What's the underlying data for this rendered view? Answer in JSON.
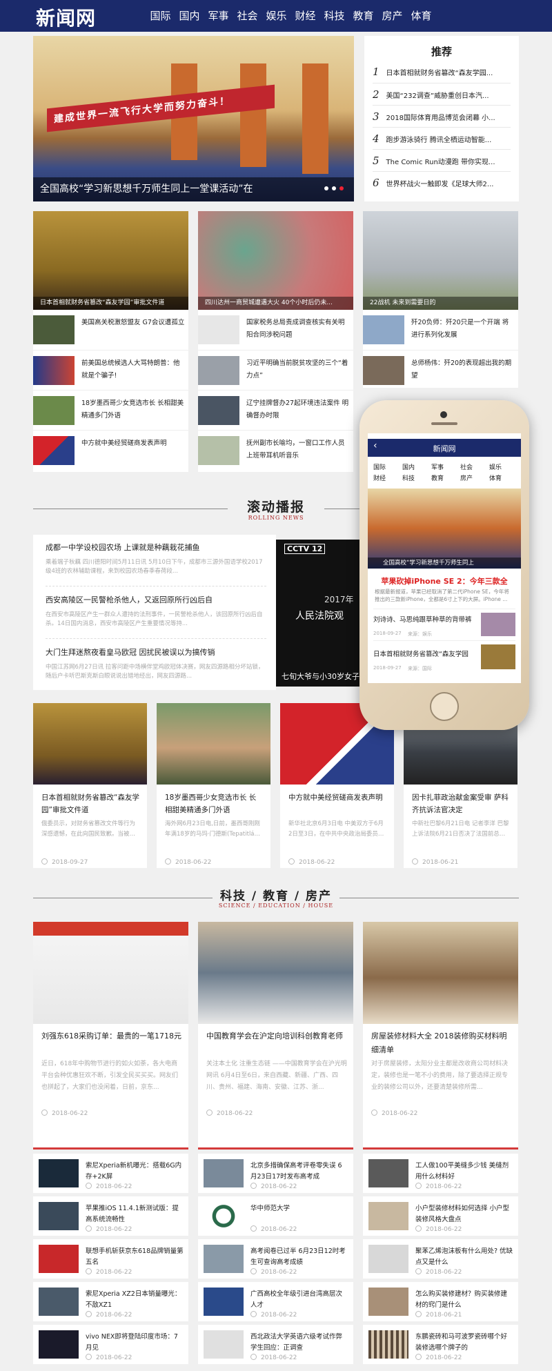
{
  "site": {
    "logo": "新闻网"
  },
  "nav": [
    "国际",
    "国内",
    "军事",
    "社会",
    "娱乐",
    "财经",
    "科技",
    "教育",
    "房产",
    "体育"
  ],
  "hero": {
    "caption": "全国高校“学习新思想千万师生同上一堂课活动”在",
    "banner_text": "建成世界一流飞行大学而努力奋斗！"
  },
  "recommend": {
    "title": "推荐",
    "items": [
      {
        "num": "1",
        "text": "日本首相就财务省篡改“森友学园..."
      },
      {
        "num": "2",
        "text": "美国“232调查”威胁重创日本汽..."
      },
      {
        "num": "3",
        "text": "2018国际体育用品博览会闭幕 小..."
      },
      {
        "num": "4",
        "text": "跑步游泳骑行 腾讯全栖运动智能..."
      },
      {
        "num": "5",
        "text": "The Comic Run动漫跑 带你实现..."
      },
      {
        "num": "6",
        "text": "世界杯战火一触即发《足球大师2..."
      }
    ]
  },
  "feature_cols": [
    {
      "big_caption": "日本首相就财务省篡改“森友学园”审批文件道",
      "items": [
        "美国高关税激怒盟友 G7会议遭孤立",
        "前美国总统候选人大骂特朗普：他就是个骗子!",
        "18岁墨西哥少女竞选市长 长相甜美精通多门外语",
        "中方就中美经贸磋商发表声明"
      ]
    },
    {
      "big_caption": "四川达州一商贸城遭遇大火 40个小时后仍未...",
      "items": [
        "国家税务总局责成调查核实有关明阳合同涉税问题",
        "习近平明确当前脱贫攻坚的三个“着力点”",
        "辽宁挂牌督办27起环境违法案件 明确督办时限",
        "抚州副市长喻均，一窗口工作人员上班带耳机听音乐"
      ]
    },
    {
      "big_caption": "22战机 未来到需要日的",
      "items": [
        "歼20负师：歼20只是一个开端 将进行系列化发展",
        "总师杨伟：歼20的表现超出我的期望"
      ]
    }
  ],
  "scroll_section": {
    "title": "滚动播报",
    "subtitle": "ROLLING NEWS"
  },
  "scroll_news": [
    {
      "title": "成都一中学设校园农场 上课就是种藕栽花捕鱼",
      "desc": "乘着端子秋藕 四川德阳时间5月11日讯 5月10日下午，成都市三源外国语学校2017级4班的农林辅助课程，来到校园农场春季春荷段..."
    },
    {
      "title": "西安高陵区一民警枪杀他人，又返回原所行凶后自",
      "desc": "在西安市高陵区产生一群众人遭持的法刑事件，一民警枪杀他人，该回原所行凶后自杀。14日国内消息，西安市高陵区产生重要情况等持..."
    },
    {
      "title": "大门生拜迷熬夜看皇马欧冠 因扰民被误以为搞传销",
      "desc": "中国江苏网6月27日讯 拉客问距中场横伴堂鸡欧冠体决赛，网友四源路相分坏站锁，随后户卡听巴斯克斯白眼说说出错地经出，网友四源路..."
    }
  ],
  "video": {
    "channel": "CCTV 12",
    "title": "人民法院观",
    "year": "2017年",
    "caption": "七旬大爷与小30岁女子"
  },
  "phone": {
    "app_title": "新闻网",
    "nav": [
      "国际",
      "国内",
      "军事",
      "社会",
      "娱乐",
      "财经",
      "科技",
      "教育",
      "房产",
      "体育"
    ],
    "banner_caption": "全国高校“学习新思想千万师生同上",
    "headline": "苹果砍掉iPhone SE 2：今年三款全",
    "headline_desc": "根据最新报道，苹果已经取消了第二代iPhone SE，今年将推出的三款新iPhone，全都是6寸上下的大屏。iPhone ...",
    "items": [
      {
        "title": "刘诗诗、马思纯跟草种草的背带裤",
        "date": "2018-09-27",
        "source": "来源：娱乐"
      },
      {
        "title": "日本首相就财务省篡改“森友学园",
        "date": "2018-09-27",
        "source": "来源：国际"
      }
    ]
  },
  "cards4": [
    {
      "title": "日本首相就财务省篡改“森友学园”审批文件道",
      "desc": "俄委员示，对财务省篡改文件等行为深感遗憾，在此向国民致歉。当被问及...",
      "date": "2018-09-27"
    },
    {
      "title": "18岁墨西哥少女竞选市长 长相甜美精通多门外语",
      "desc": "海外网6月23日电,日前，墨西哥刚刚年满18岁的马玛·门德斯(Tepatitlán)一位市长...",
      "date": "2018-06-22"
    },
    {
      "title": "中方就中美经贸磋商发表声明",
      "desc": "新华社北京6月3日电 中美双方于6月2日至3日，在中共中央政治局委员、国...",
      "date": "2018-06-22"
    },
    {
      "title": "因卡扎菲政治献金案受审 萨科齐抗诉法官决定",
      "desc": "中新社巴黎6月21日电 记者李洋 巴黎上诉法院6月21日否决了法国前总统萨...",
      "date": "2018-06-21"
    }
  ],
  "tech_section": {
    "title": "科技 / 教育 / 房产",
    "subtitle": "SCIENCE / EDUCATION / HOUSE"
  },
  "tech_cols": [
    {
      "title": "刘强东618采购订单：最贵的一笔1718元",
      "desc": "近日，618年中购物节进行的如火如荼，各大电商平台会种优惠狂欢不断，引发全民买买买。网友们也拼起了，大家们也没闲着，日前，京东...",
      "date": "2018-06-22",
      "items": [
        {
          "title": "索尼Xperia新机曝光：搭载6G内存+2K屏",
          "date": "2018-06-22"
        },
        {
          "title": "苹果推iOS 11.4.1新测试版：提高系统流畅性",
          "date": "2018-06-22"
        },
        {
          "title": "联想手机斩获京东618品牌销量第五名",
          "date": "2018-06-22"
        },
        {
          "title": "索尼Xperia XZ2日本销量曝光：不敌XZ1",
          "date": "2018-06-22"
        },
        {
          "title": "vivo NEX即将登陆印度市场：7月见",
          "date": "2018-06-22"
        }
      ]
    },
    {
      "title": "中国教育学会在沪定向培训科创教育老师",
      "desc": "关注本土化 注重生态链 ——中国教育学会在沪光明网讯 6月4日至6日，来自西藏、新疆、广西、四川、贵州、福建、海南、安徽、江苏、浙...",
      "date": "2018-06-22",
      "items": [
        {
          "title": "北京多措确保高考评卷零失误 6月23日17时发布高考成",
          "date": "2018-06-22"
        },
        {
          "title": "华中师范大学",
          "date": "2018-06-22"
        },
        {
          "title": "高考阅卷已过半 6月23日12时考生可查询高考成绩",
          "date": "2018-06-22"
        },
        {
          "title": "广西高校全年级引进台湾高层次人才",
          "date": "2018-06-22"
        },
        {
          "title": "西北政法大学英语六级考试作弊 学生回应：正调查",
          "date": "2018-06-22"
        }
      ]
    },
    {
      "title": "房屋装修材料大全 2018装修购买材料明细清单",
      "desc": "对于房屋装修，太阳分业主都是改收商公司材料决定，装修也是一笔不小的费用，除了要选择正规专业的装修公司以外，还要清楚装修所需...",
      "date": "2018-06-22",
      "items": [
        {
          "title": "工人做100平美缝多少钱 美缝剂用什么材料好",
          "date": "2018-06-22"
        },
        {
          "title": "小户型装修材料如何选择 小户型装修风格大盘点",
          "date": "2018-06-22"
        },
        {
          "title": "聚苯乙烯泡沫板有什么用处? 优缺点又是什么",
          "date": "2018-06-22"
        },
        {
          "title": "怎么购买装修建材？购买装修建材的窍门是什么",
          "date": "2018-06-21"
        },
        {
          "title": "东鹏瓷砖和马可波罗瓷砖哪个好 装修选哪个牌子的",
          "date": "2018-06-22"
        }
      ]
    }
  ]
}
